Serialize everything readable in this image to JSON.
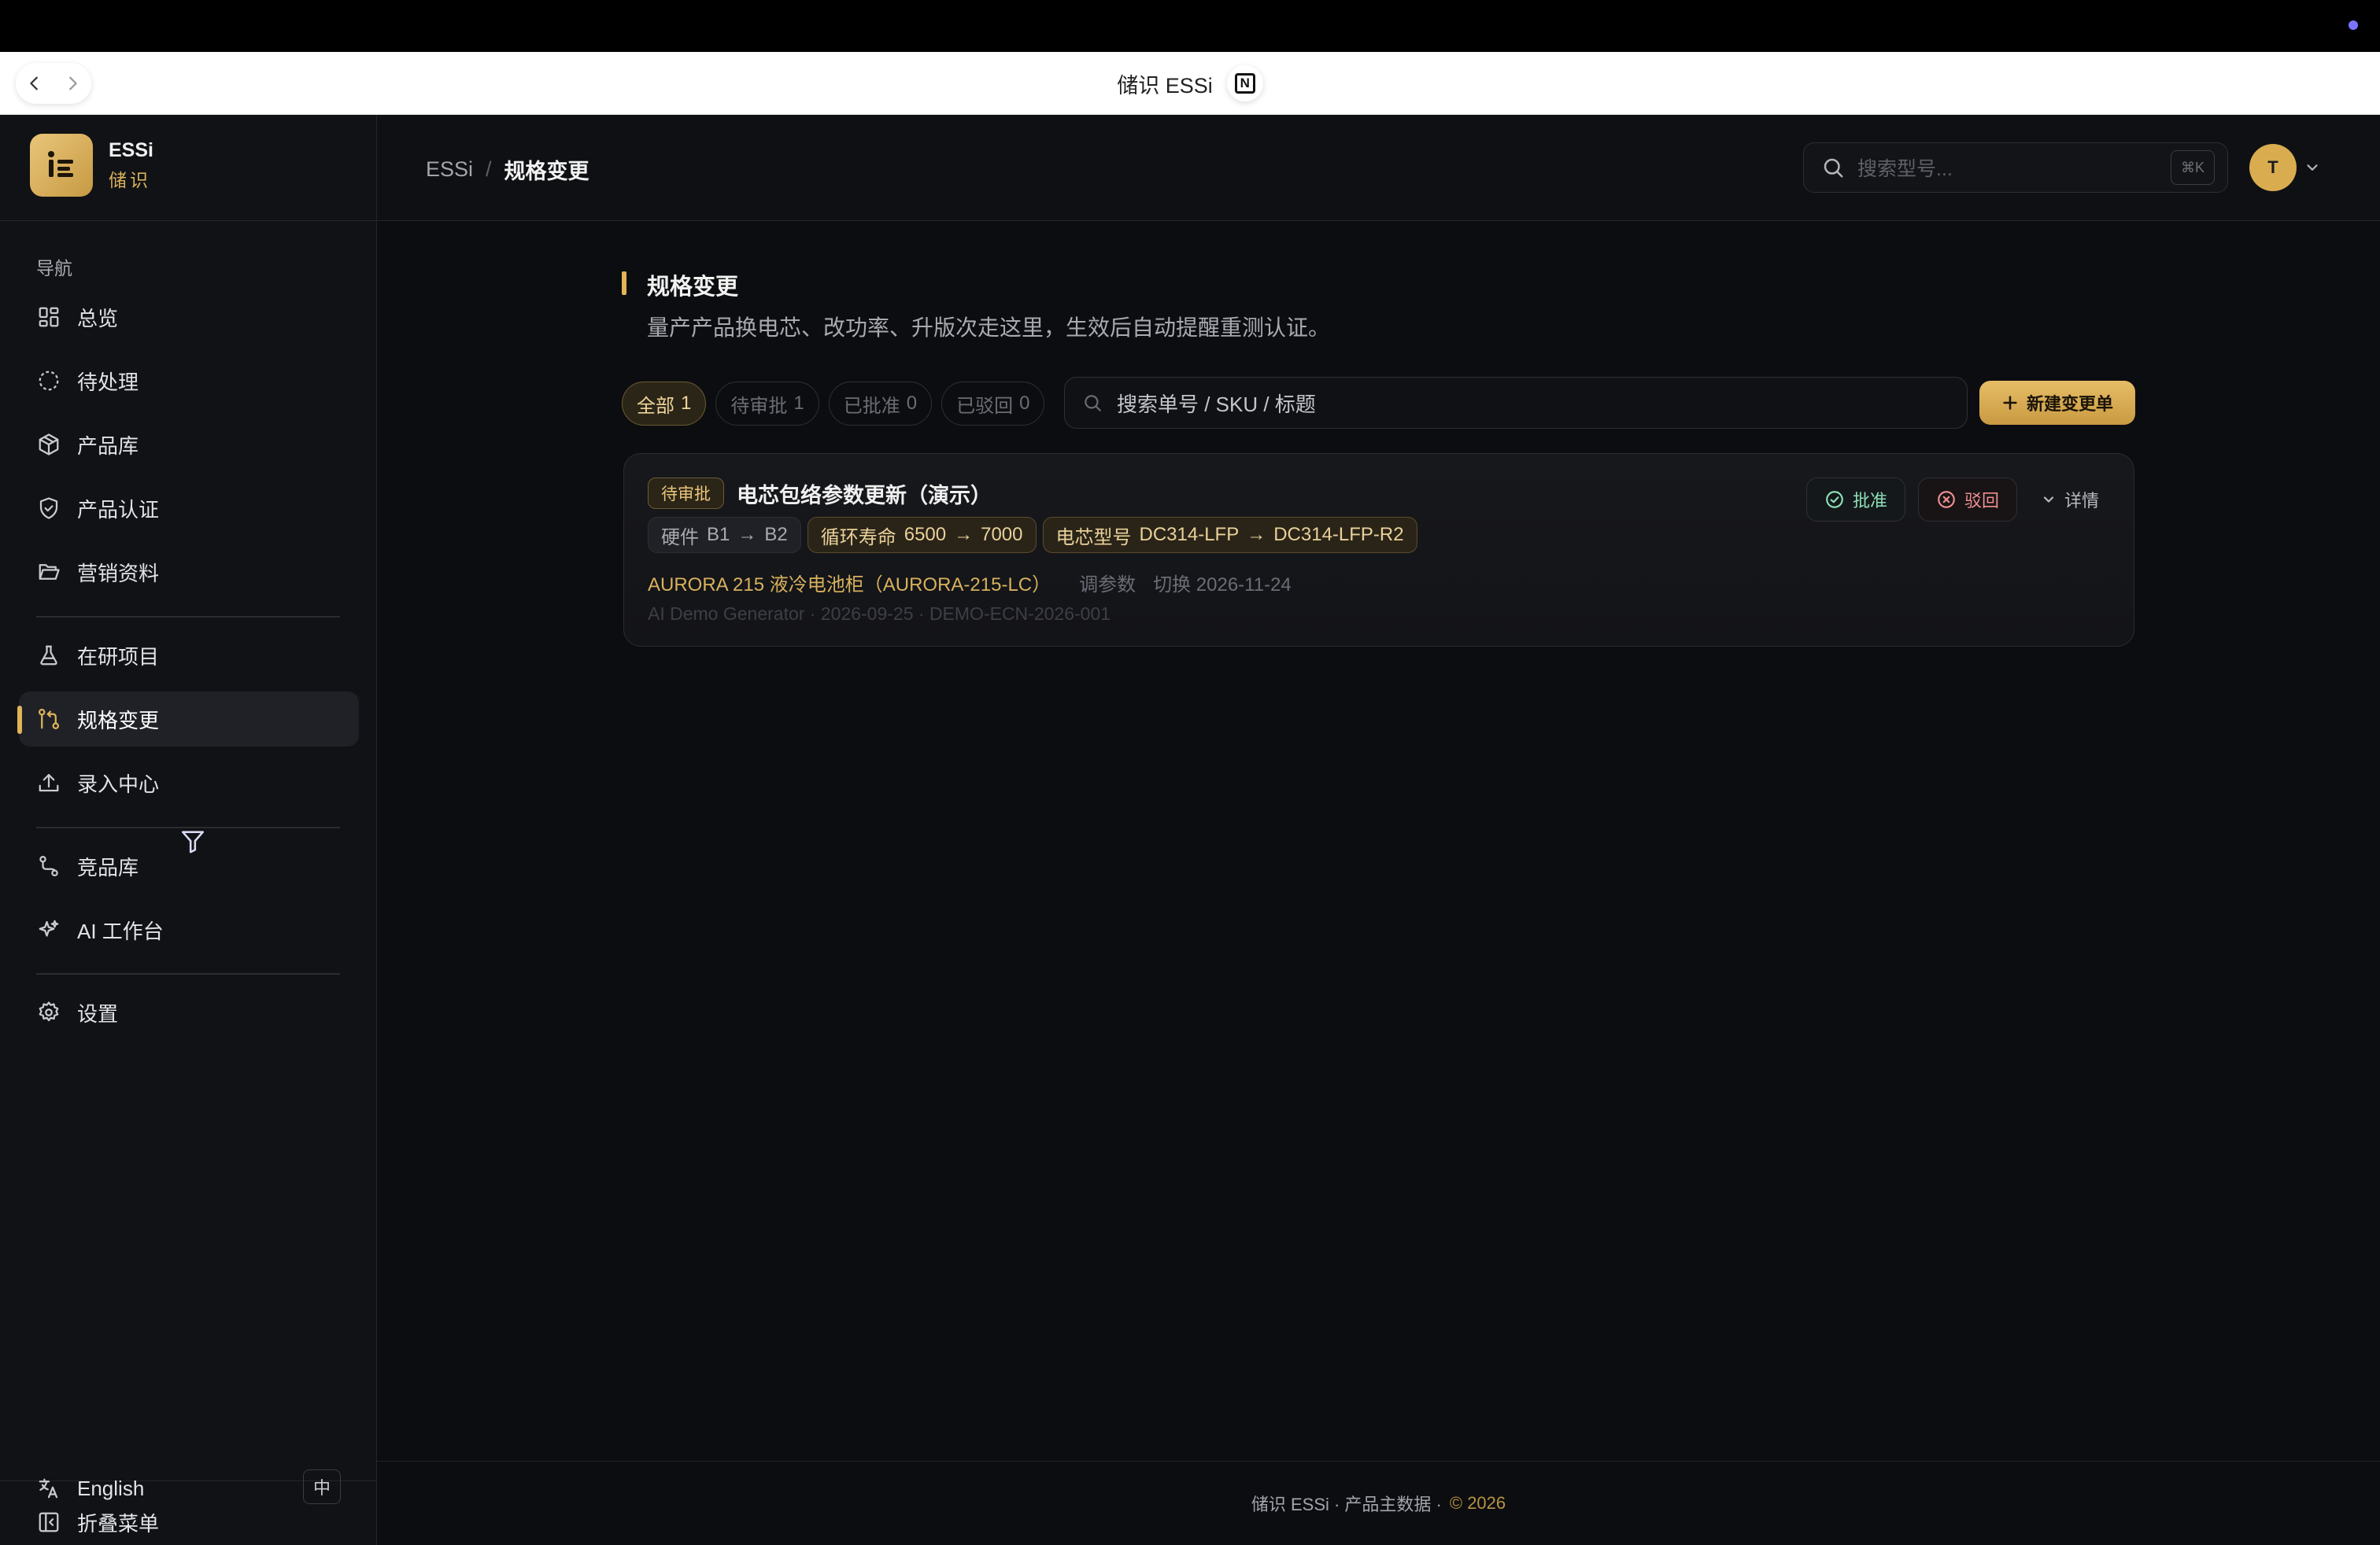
{
  "browser": {
    "title": "储识 ESSi"
  },
  "brand": {
    "name": "ESSi",
    "subtitle": "储识"
  },
  "sidebar": {
    "section_label": "导航",
    "items": [
      {
        "label": "总览",
        "icon": "dashboard-icon"
      },
      {
        "label": "待处理",
        "icon": "dashed-circle-icon"
      },
      {
        "label": "产品库",
        "icon": "package-icon"
      },
      {
        "label": "产品认证",
        "icon": "shield-check-icon"
      },
      {
        "label": "营销资料",
        "icon": "folder-open-icon"
      },
      {
        "label": "在研项目",
        "icon": "flask-icon"
      },
      {
        "label": "规格变更",
        "icon": "git-compare-icon",
        "active": true
      },
      {
        "label": "录入中心",
        "icon": "upload-icon"
      },
      {
        "label": "竞品库",
        "icon": "route-icon"
      },
      {
        "label": "AI 工作台",
        "icon": "sparkles-icon"
      },
      {
        "label": "设置",
        "icon": "gear-icon"
      }
    ],
    "collapse_label": "折叠菜单",
    "language_label": "English",
    "language_key": "中"
  },
  "header": {
    "breadcrumb_root": "ESSi",
    "breadcrumb_sep": "/",
    "breadcrumb_current": "规格变更",
    "search_placeholder": "搜索型号...",
    "search_shortcut": "⌘K",
    "avatar_initial": "T"
  },
  "page": {
    "title": "规格变更",
    "subtitle": "量产产品换电芯、改功率、升版次走这里，生效后自动提醒重测认证。"
  },
  "filters": [
    {
      "label": "全部",
      "count": "1",
      "active": true
    },
    {
      "label": "待审批",
      "count": "1"
    },
    {
      "label": "已批准",
      "count": "0"
    },
    {
      "label": "已驳回",
      "count": "0"
    }
  ],
  "list_search_placeholder": "搜索单号 / SKU / 标题",
  "new_button_label": "新建变更单",
  "change_order": {
    "status": "待审批",
    "title": "电芯包络参数更新（演示）",
    "tags": [
      {
        "label": "硬件",
        "from": "B1",
        "to": "B2",
        "style": "gray"
      },
      {
        "label": "循环寿命",
        "from": "6500",
        "to": "7000",
        "style": "gold"
      },
      {
        "label": "电芯型号",
        "from": "DC314-LFP",
        "to": "DC314-LFP-R2",
        "style": "gold"
      }
    ],
    "product": "AURORA 215 液冷电池柜（AURORA-215-LC）",
    "change_type": "调参数",
    "switch_date": "切换 2026-11-24",
    "meta": "AI Demo Generator · 2026-09-25 · DEMO-ECN-2026-001",
    "approve_label": "批准",
    "reject_label": "驳回",
    "detail_label": "详情"
  },
  "footer": {
    "text": "储识 ESSi · 产品主数据 ·",
    "copyright": "© 2026"
  },
  "colors": {
    "accent": "#e0b457",
    "background": "#0c0d10",
    "sidebar": "#111215",
    "approve": "#8de0b8",
    "reject": "#ef8f8f"
  }
}
